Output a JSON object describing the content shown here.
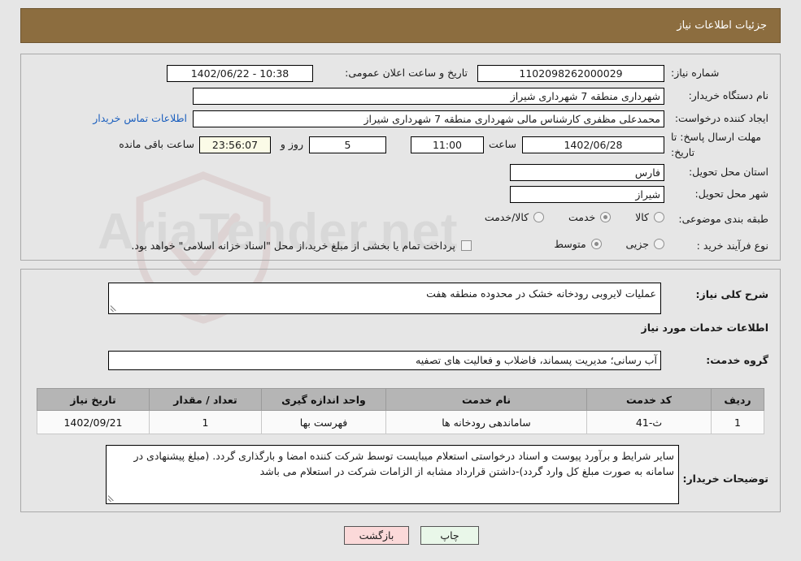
{
  "header": {
    "title": "جزئیات اطلاعات نیاز"
  },
  "watermark": {
    "text": "AriaTender.net"
  },
  "form": {
    "need_number": {
      "label": "شماره نیاز:",
      "value": "1102098262000029"
    },
    "announce_datetime": {
      "label": "تاریخ و ساعت اعلان عمومی:",
      "value": "10:38 - 1402/06/22"
    },
    "buyer_org": {
      "label": "نام دستگاه خریدار:",
      "value": "شهرداری منطقه 7 شهرداری شیراز"
    },
    "requester": {
      "label": "ایجاد کننده درخواست:",
      "value": "محمدعلی مظفری کارشناس مالی شهرداری منطقه 7 شهرداری شیراز"
    },
    "contact_link": "اطلاعات تماس خریدار",
    "deadline": {
      "label": "مهلت ارسال پاسخ: تا تاریخ:",
      "date": "1402/06/28",
      "time_label": "ساعت",
      "time": "11:00",
      "days": "5",
      "days_label": "روز و",
      "countdown": "23:56:07",
      "countdown_label": "ساعت باقی مانده"
    },
    "province": {
      "label": "استان محل تحویل:",
      "value": "فارس"
    },
    "city": {
      "label": "شهر محل تحویل:",
      "value": "شیراز"
    },
    "category": {
      "label": "طبقه بندی موضوعی:",
      "options": [
        {
          "label": "کالا",
          "selected": false
        },
        {
          "label": "خدمت",
          "selected": true
        },
        {
          "label": "کالا/خدمت",
          "selected": false
        }
      ]
    },
    "process_type": {
      "label": "نوع فرآیند خرید :",
      "options": [
        {
          "label": "جزیی",
          "selected": false
        },
        {
          "label": "متوسط",
          "selected": true
        }
      ],
      "checkbox": {
        "checked": false,
        "label": "پرداخت تمام یا بخشی از مبلغ خرید،از محل \"اسناد خزانه اسلامی\" خواهد بود."
      }
    },
    "general_desc": {
      "label": "شرح کلی نیاز:",
      "value": "عملیات لایروبی رودخانه خشک در محدوده منطقه هفت"
    },
    "services_section_title": "اطلاعات خدمات مورد نیاز",
    "service_group": {
      "label": "گروه خدمت:",
      "value": "آب رسانی؛ مدیریت پسماند، فاضلاب و فعالیت های تصفیه"
    },
    "buyer_notes": {
      "label": "توضیحات خریدار:",
      "value": "سایر شرایط و برآورد پیوست و اسناد درخواستی استعلام میبایست توسط شرکت کننده امضا و بارگذاری گردد. (مبلغ پیشنهادی در سامانه به صورت مبلغ کل وارد گردد)-داشتن قرارداد مشابه از الزامات شرکت در استعلام می باشد"
    }
  },
  "table": {
    "columns": [
      "ردیف",
      "کد خدمت",
      "نام خدمت",
      "واحد اندازه گیری",
      "تعداد / مقدار",
      "تاریخ نیاز"
    ],
    "rows": [
      {
        "index": "1",
        "code": "ث-41",
        "name": "ساماندهی رودخانه ها",
        "unit": "فهرست بها",
        "qty": "1",
        "need_date": "1402/09/21"
      }
    ]
  },
  "buttons": {
    "print": "چاپ",
    "back": "بازگشت"
  },
  "colors": {
    "header_bar": "#8c6d3f",
    "page_bg": "#e6e6e6",
    "link": "#1b5fbe",
    "table_header": "#b5b5b5",
    "print_btn": "#e9f7e9",
    "back_btn": "#fbd9d9"
  }
}
